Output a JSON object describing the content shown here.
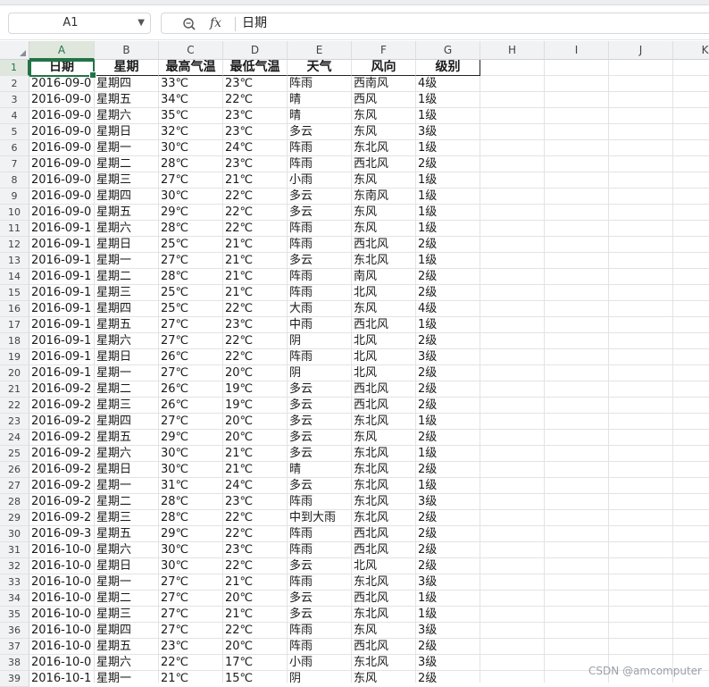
{
  "formula_bar": {
    "cell_ref": "A1",
    "zoom_icon": "zoom-icon",
    "fx_label": "fx",
    "content": "日期"
  },
  "columns": [
    "A",
    "B",
    "C",
    "D",
    "E",
    "F",
    "G",
    "H",
    "I",
    "J",
    "K"
  ],
  "row_numbers": [
    "1",
    "2",
    "3",
    "4",
    "5",
    "6",
    "7",
    "8",
    "9",
    "10",
    "11",
    "12",
    "13",
    "14",
    "15",
    "16",
    "17",
    "18",
    "19",
    "20",
    "21",
    "22",
    "23",
    "24",
    "25",
    "26",
    "27",
    "28",
    "29",
    "30",
    "31",
    "32",
    "33",
    "34",
    "35",
    "36",
    "37",
    "38",
    "39"
  ],
  "table": {
    "headers": [
      "日期",
      "星期",
      "最高气温",
      "最低气温",
      "天气",
      "风向",
      "级别"
    ],
    "rows": [
      [
        "2016-09-0",
        "星期四",
        "33℃",
        "23℃",
        "阵雨",
        "西南风",
        "4级"
      ],
      [
        "2016-09-0",
        "星期五",
        "34℃",
        "22℃",
        "晴",
        "西风",
        "1级"
      ],
      [
        "2016-09-0",
        "星期六",
        "35℃",
        "23℃",
        "晴",
        "东风",
        "1级"
      ],
      [
        "2016-09-0",
        "星期日",
        "32℃",
        "23℃",
        "多云",
        "东风",
        "3级"
      ],
      [
        "2016-09-0",
        "星期一",
        "30℃",
        "24℃",
        "阵雨",
        "东北风",
        "1级"
      ],
      [
        "2016-09-0",
        "星期二",
        "28℃",
        "23℃",
        "阵雨",
        "西北风",
        "2级"
      ],
      [
        "2016-09-0",
        "星期三",
        "27℃",
        "21℃",
        "小雨",
        "东风",
        "1级"
      ],
      [
        "2016-09-0",
        "星期四",
        "30℃",
        "22℃",
        "多云",
        "东南风",
        "1级"
      ],
      [
        "2016-09-0",
        "星期五",
        "29℃",
        "22℃",
        "多云",
        "东风",
        "1级"
      ],
      [
        "2016-09-1",
        "星期六",
        "28℃",
        "22℃",
        "阵雨",
        "东风",
        "1级"
      ],
      [
        "2016-09-1",
        "星期日",
        "25℃",
        "21℃",
        "阵雨",
        "西北风",
        "2级"
      ],
      [
        "2016-09-1",
        "星期一",
        "27℃",
        "21℃",
        "多云",
        "东北风",
        "1级"
      ],
      [
        "2016-09-1",
        "星期二",
        "28℃",
        "21℃",
        "阵雨",
        "南风",
        "2级"
      ],
      [
        "2016-09-1",
        "星期三",
        "25℃",
        "21℃",
        "阵雨",
        "北风",
        "2级"
      ],
      [
        "2016-09-1",
        "星期四",
        "25℃",
        "22℃",
        "大雨",
        "东风",
        "4级"
      ],
      [
        "2016-09-1",
        "星期五",
        "27℃",
        "23℃",
        "中雨",
        "西北风",
        "1级"
      ],
      [
        "2016-09-1",
        "星期六",
        "27℃",
        "22℃",
        "阴",
        "北风",
        "2级"
      ],
      [
        "2016-09-1",
        "星期日",
        "26℃",
        "22℃",
        "阵雨",
        "北风",
        "3级"
      ],
      [
        "2016-09-1",
        "星期一",
        "27℃",
        "20℃",
        "阴",
        "北风",
        "2级"
      ],
      [
        "2016-09-2",
        "星期二",
        "26℃",
        "19℃",
        "多云",
        "西北风",
        "2级"
      ],
      [
        "2016-09-2",
        "星期三",
        "26℃",
        "19℃",
        "多云",
        "西北风",
        "2级"
      ],
      [
        "2016-09-2",
        "星期四",
        "27℃",
        "20℃",
        "多云",
        "东北风",
        "1级"
      ],
      [
        "2016-09-2",
        "星期五",
        "29℃",
        "20℃",
        "多云",
        "东风",
        "2级"
      ],
      [
        "2016-09-2",
        "星期六",
        "30℃",
        "21℃",
        "多云",
        "东北风",
        "1级"
      ],
      [
        "2016-09-2",
        "星期日",
        "30℃",
        "21℃",
        "晴",
        "东北风",
        "2级"
      ],
      [
        "2016-09-2",
        "星期一",
        "31℃",
        "24℃",
        "多云",
        "东北风",
        "1级"
      ],
      [
        "2016-09-2",
        "星期二",
        "28℃",
        "23℃",
        "阵雨",
        "东北风",
        "3级"
      ],
      [
        "2016-09-2",
        "星期三",
        "28℃",
        "22℃",
        "中到大雨",
        "东北风",
        "2级"
      ],
      [
        "2016-09-3",
        "星期五",
        "29℃",
        "22℃",
        "阵雨",
        "西北风",
        "2级"
      ],
      [
        "2016-10-0",
        "星期六",
        "30℃",
        "23℃",
        "阵雨",
        "西北风",
        "2级"
      ],
      [
        "2016-10-0",
        "星期日",
        "30℃",
        "22℃",
        "多云",
        "北风",
        "2级"
      ],
      [
        "2016-10-0",
        "星期一",
        "27℃",
        "21℃",
        "阵雨",
        "东北风",
        "3级"
      ],
      [
        "2016-10-0",
        "星期二",
        "27℃",
        "20℃",
        "多云",
        "西北风",
        "1级"
      ],
      [
        "2016-10-0",
        "星期三",
        "27℃",
        "21℃",
        "多云",
        "东北风",
        "1级"
      ],
      [
        "2016-10-0",
        "星期四",
        "27℃",
        "22℃",
        "阵雨",
        "东风",
        "3级"
      ],
      [
        "2016-10-0",
        "星期五",
        "23℃",
        "20℃",
        "阵雨",
        "西北风",
        "2级"
      ],
      [
        "2016-10-0",
        "星期六",
        "22℃",
        "17℃",
        "小雨",
        "东北风",
        "3级"
      ],
      [
        "2016-10-1",
        "星期一",
        "21℃",
        "15℃",
        "阴",
        "东风",
        "2级"
      ]
    ]
  },
  "watermark": "CSDN @amcomputer",
  "colors": {
    "accent": "#217346",
    "header_bg": "#f1f2f4",
    "grid_line": "#e1e3e6"
  }
}
